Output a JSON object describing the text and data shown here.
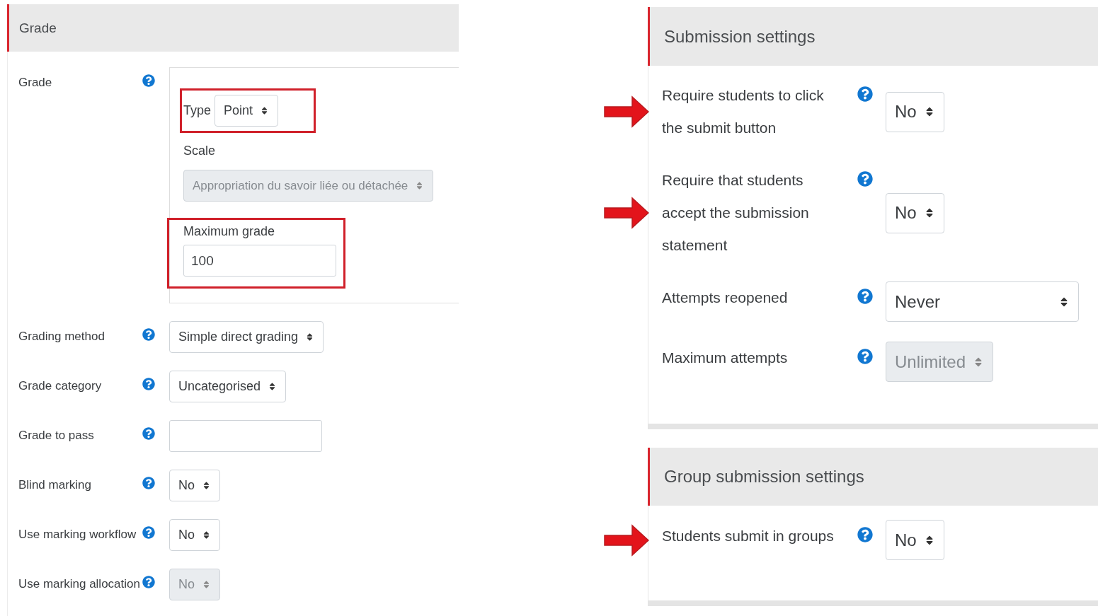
{
  "grade_panel": {
    "title": "Grade",
    "group": {
      "label": "Grade",
      "items": [
        {
          "kind": "inline-select",
          "label": "Type",
          "value": "Point",
          "disabled": false,
          "highlighted": true
        },
        {
          "kind": "select",
          "label": "Scale",
          "value": "Appropriation du savoir liée ou détachée",
          "disabled": true,
          "highlighted": false
        },
        {
          "kind": "input",
          "label": "Maximum grade",
          "value": "100",
          "disabled": false,
          "highlighted": true
        }
      ]
    },
    "fields": [
      {
        "label": "Grading method",
        "kind": "select",
        "value": "Simple direct grading",
        "disabled": false
      },
      {
        "label": "Grade category",
        "kind": "select",
        "value": "Uncategorised",
        "disabled": false
      },
      {
        "label": "Grade to pass",
        "kind": "input",
        "disabled": false
      },
      {
        "label": "Blind marking",
        "kind": "select",
        "value": "No",
        "disabled": false
      },
      {
        "label": "Use marking workflow",
        "kind": "select",
        "value": "No",
        "disabled": false
      },
      {
        "label": "Use marking allocation",
        "kind": "select",
        "value": "No",
        "disabled": true
      }
    ]
  },
  "sections": [
    {
      "title": "Submission settings",
      "fields": [
        {
          "label": "Require students to click the submit button",
          "kind": "select",
          "value": "No",
          "disabled": false,
          "arrow": true
        },
        {
          "label": "Require that students accept the submission statement",
          "kind": "select",
          "value": "No",
          "disabled": false,
          "arrow": true
        },
        {
          "label": "Attempts reopened",
          "kind": "wide-select",
          "value": "Never",
          "disabled": false,
          "arrow": false
        },
        {
          "label": "Maximum attempts",
          "kind": "select",
          "value": "Unlimited",
          "disabled": true,
          "arrow": false
        }
      ]
    },
    {
      "title": "Group submission settings",
      "fields": [
        {
          "label": "Students submit in groups",
          "kind": "select",
          "value": "No",
          "disabled": false,
          "arrow": true
        }
      ]
    }
  ]
}
